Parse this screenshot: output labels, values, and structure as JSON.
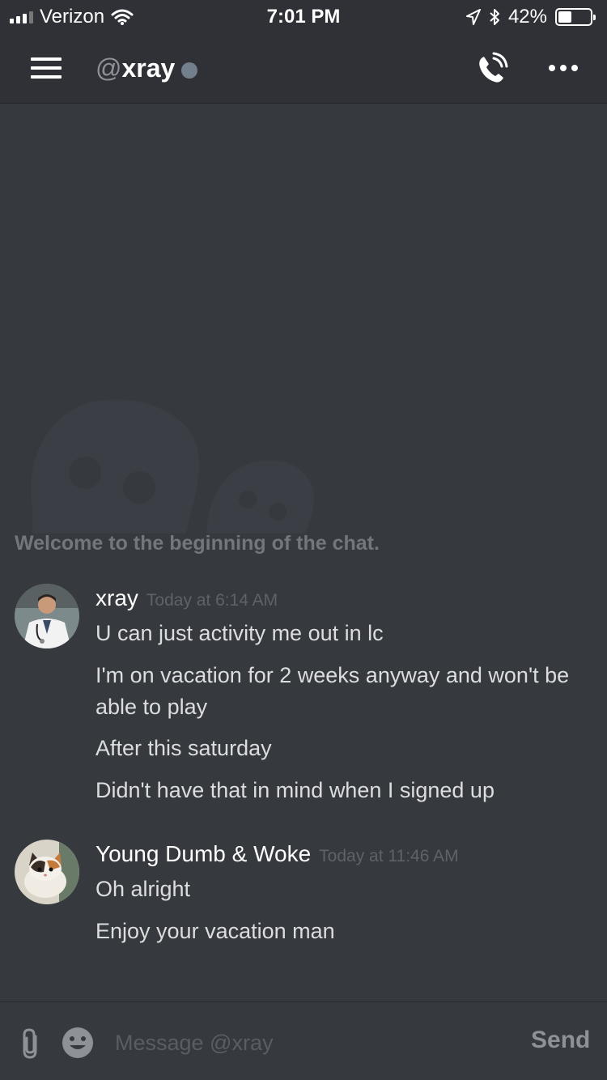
{
  "status_bar": {
    "carrier": "Verizon",
    "time": "7:01 PM",
    "battery_label": "42%",
    "battery_level": 0.42
  },
  "header": {
    "at_symbol": "@",
    "username": "xray",
    "presence_color": "#747f8d"
  },
  "chat": {
    "welcome": "Welcome to the beginning of the chat.",
    "messages": [
      {
        "author": "xray",
        "timestamp": "Today at 6:14 AM",
        "avatar": "doctor-avatar",
        "lines": [
          "U can just activity me out in lc",
          "I'm on vacation for 2 weeks anyway and won't be able to play",
          "After this saturday",
          "Didn't have that in mind when I signed up"
        ]
      },
      {
        "author": "Young Dumb & Woke",
        "timestamp": "Today at 11:46 AM",
        "avatar": "kitten-avatar",
        "lines": [
          "Oh alright",
          "Enjoy your vacation man"
        ]
      }
    ]
  },
  "composer": {
    "placeholder": "Message @xray",
    "send_label": "Send"
  },
  "colors": {
    "background": "#36393e",
    "header": "#2f3136",
    "text": "#dcddde",
    "muted": "#72767d"
  }
}
